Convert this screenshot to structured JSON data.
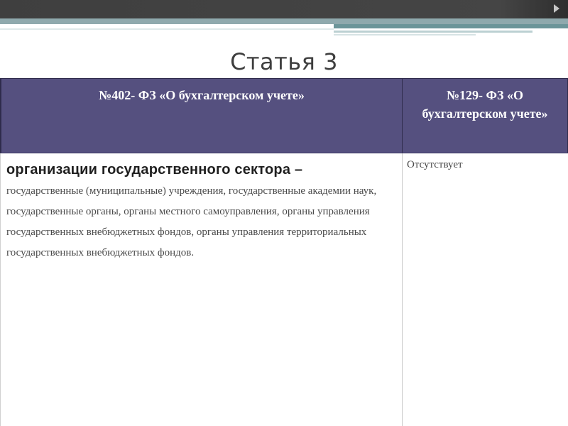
{
  "slide": {
    "title": "Статья 3"
  },
  "table": {
    "headers": [
      "№402- ФЗ «О бухгалтерском учете»",
      "№129- ФЗ «О бухгалтерском учете»"
    ],
    "row": {
      "term": "организации государственного сектора –",
      "definition": "государственные (муниципальные) учреждения, государственные академии наук, государственные органы, органы местного самоуправления, органы управления государственных внебюджетных фондов, органы управления территориальных государственных внебюджетных фондов.",
      "other": "Отсутствует"
    }
  },
  "colors": {
    "header_bg": "#55507f",
    "header_text": "#ffffff",
    "top_bar": "#454545",
    "accent_teal": "#6c9599"
  }
}
